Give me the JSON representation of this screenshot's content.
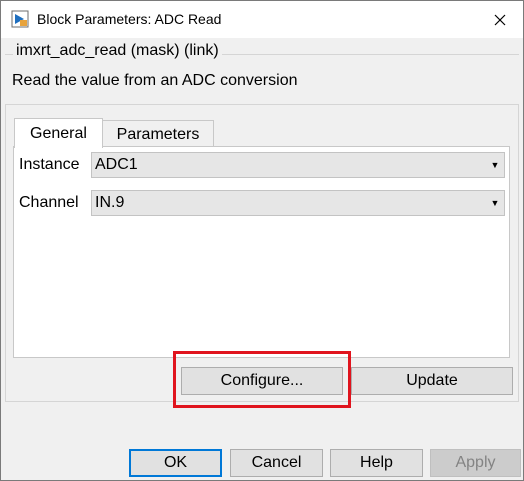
{
  "window": {
    "title": "Block Parameters: ADC Read",
    "app_icon": "simulink-block-icon",
    "close_icon": "close-icon"
  },
  "mask": {
    "title": "imxrt_adc_read (mask) (link)",
    "description": "Read the value from an ADC conversion"
  },
  "tabs": [
    {
      "label": "General",
      "selected": true
    },
    {
      "label": "Parameters",
      "selected": false
    }
  ],
  "fields": {
    "instance": {
      "label": "Instance",
      "value": "ADC1"
    },
    "channel": {
      "label": "Channel",
      "value": "IN.9"
    }
  },
  "panel_buttons": {
    "configure": "Configure...",
    "update": "Update"
  },
  "dialog_buttons": {
    "ok": "OK",
    "cancel": "Cancel",
    "help": "Help",
    "apply": "Apply"
  },
  "colors": {
    "highlight": "#e0141e",
    "default_button_border": "#0078d7"
  }
}
